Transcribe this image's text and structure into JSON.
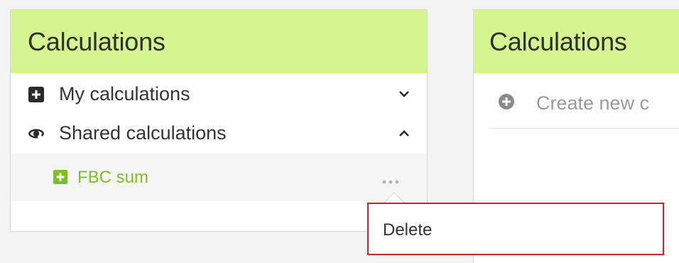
{
  "left_panel": {
    "title": "Calculations",
    "items": [
      {
        "label": "My calculations",
        "icon": "plus-box-icon",
        "chevron": "chevron-down-icon"
      },
      {
        "label": "Shared calculations",
        "icon": "shared-eye-icon",
        "chevron": "chevron-up-icon"
      }
    ],
    "sub_item": {
      "label": "FBC sum",
      "icon": "plus-box-icon",
      "menu_icon": "more-dots-icon"
    }
  },
  "right_panel": {
    "title": "Calculations",
    "create_label": "Create new c",
    "create_icon": "plus-circle-icon"
  },
  "context_menu": {
    "delete_label": "Delete"
  },
  "colors": {
    "header_bg": "#d4f590",
    "accent_green": "#7cc023",
    "highlight_border": "#d91f26"
  }
}
